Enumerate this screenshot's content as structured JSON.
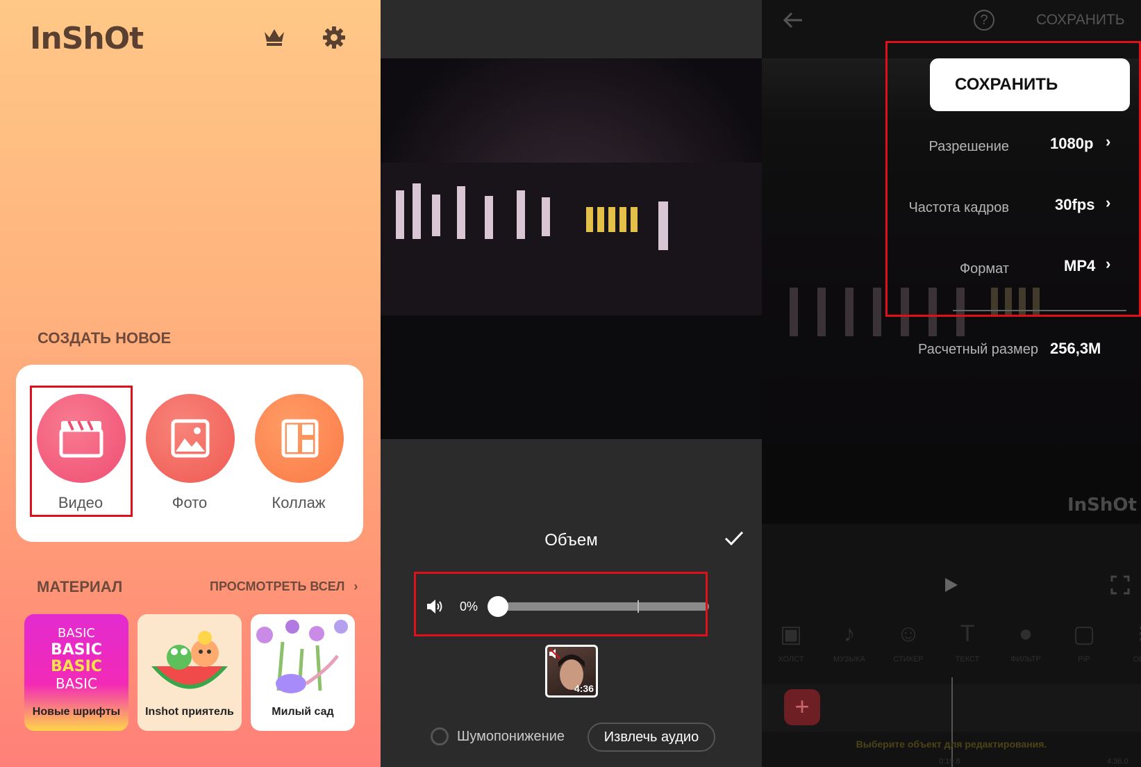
{
  "panel1": {
    "logo": "InShOt",
    "create_section": "СОЗДАТЬ НОВОЕ",
    "create_items": [
      {
        "label": "Видео",
        "icon": "clapperboard-icon"
      },
      {
        "label": "Фото",
        "icon": "image-icon"
      },
      {
        "label": "Коллаж",
        "icon": "collage-icon"
      }
    ],
    "material_section": "МАТЕРИАЛ",
    "view_all": "ПРОСМОТРЕТЬ ВСЕЛ",
    "materials": [
      {
        "label": "Новые шрифты",
        "art": [
          "BASIC",
          "BASIC",
          "BASIC",
          "BASIC"
        ]
      },
      {
        "label": "Inshot приятель"
      },
      {
        "label": "Милый сад"
      }
    ],
    "colors": {
      "video": "#f4607e",
      "photo": "#f56a5e",
      "collage": "#ff8a56"
    }
  },
  "panel2": {
    "volume_title": "Объем",
    "volume_percent": "0%",
    "volume_level": 0,
    "clip_duration": "4:36",
    "denoise_label": "Шумопонижение",
    "extract_audio_label": "Извлечь аудио"
  },
  "panel3": {
    "help": "?",
    "save_top": "СОХРАНИТЬ",
    "save_button": "СОХРАНИТЬ",
    "resolution_label": "Разрешение",
    "resolution_value": "1080p",
    "fps_label": "Частота кадров",
    "fps_value": "30fps",
    "format_label": "Формат",
    "format_value": "MP4",
    "size_label": "Расчетный размер",
    "size_value": "256,3M",
    "watermark": "InShOt",
    "tools": [
      {
        "label": "ХОЛСТ",
        "icon": "canvas-icon"
      },
      {
        "label": "МУЗЫКА",
        "icon": "music-icon"
      },
      {
        "label": "СТИКЕР",
        "icon": "sticker-icon"
      },
      {
        "label": "ТЕКСТ",
        "icon": "text-icon"
      },
      {
        "label": "ФИЛЬТР",
        "icon": "filter-icon"
      },
      {
        "label": "PIP",
        "icon": "pip-icon"
      },
      {
        "label": "ОБР",
        "icon": "crop-icon"
      }
    ],
    "hint": "Выберите объект для редактирования.",
    "time_current": "0:19.8",
    "time_total": "4:36.0"
  }
}
